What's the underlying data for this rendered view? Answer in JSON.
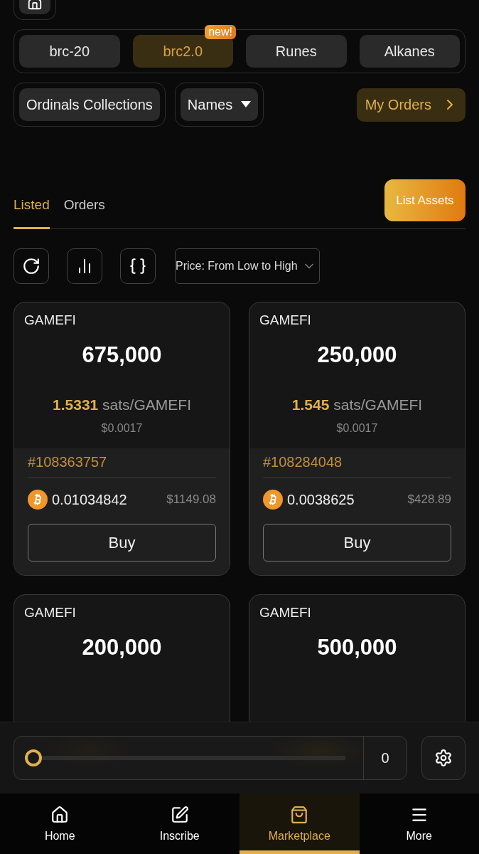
{
  "categories": [
    {
      "label": "brc-20",
      "selected": false
    },
    {
      "label": "brc2.0",
      "selected": true,
      "badge": "new!"
    },
    {
      "label": "Runes",
      "selected": false
    },
    {
      "label": "Alkanes",
      "selected": false
    }
  ],
  "filters": {
    "collections": "Ordinals Collections",
    "names": "Names",
    "my_orders": "My Orders"
  },
  "tabs": [
    {
      "label": "Listed",
      "selected": true
    },
    {
      "label": "Orders",
      "selected": false
    }
  ],
  "list_button": "List Assets",
  "sort": {
    "value": "Price: From Low to High"
  },
  "cards": [
    {
      "ticker": "GAMEFI",
      "amount": "675,000",
      "unit_price": "1.5331",
      "unit": "sats/GAMEFI",
      "unit_usd": "$0.0017",
      "inscription": "#108363757",
      "btc": "0.01034842",
      "usd": "$1149.08",
      "button": "Buy"
    },
    {
      "ticker": "GAMEFI",
      "amount": "250,000",
      "unit_price": "1.545",
      "unit": "sats/GAMEFI",
      "unit_usd": "$0.0017",
      "inscription": "#108284048",
      "btc": "0.0038625",
      "usd": "$428.89",
      "button": "Buy"
    },
    {
      "ticker": "GAMEFI",
      "amount": "200,000"
    },
    {
      "ticker": "GAMEFI",
      "amount": "500,000"
    }
  ],
  "sweep": {
    "level": 0,
    "count": "0"
  },
  "nav": [
    {
      "label": "Home",
      "selected": false
    },
    {
      "label": "Inscribe",
      "selected": false
    },
    {
      "label": "Marketplace",
      "selected": true
    },
    {
      "label": "More",
      "selected": false
    }
  ]
}
